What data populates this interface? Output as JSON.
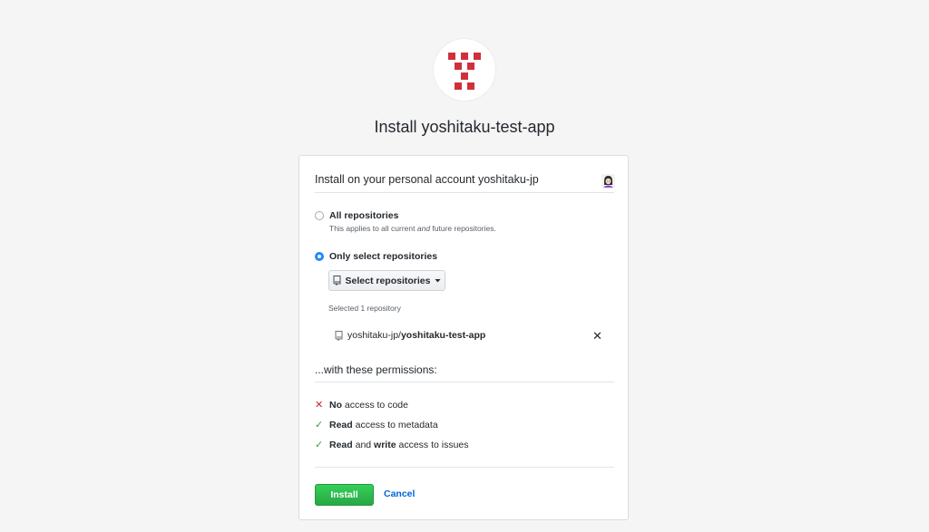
{
  "app": {
    "title": "Install yoshitaku-test-app",
    "logo_icon": "app-logo-icon",
    "logo_color": "#d0303b"
  },
  "account": {
    "label": "Install on your personal account yoshitaku-jp",
    "avatar_icon": "user-avatar-icon"
  },
  "options": {
    "all": {
      "label": "All repositories",
      "desc_prefix": "This applies to all current ",
      "desc_em": "and",
      "desc_suffix": " future repositories.",
      "selected": false
    },
    "select": {
      "label": "Only select repositories",
      "selected": true
    }
  },
  "repo_selector": {
    "button_label": "Select repositories",
    "icon": "repo-icon",
    "caret_icon": "caret-down-icon",
    "selected_count_text": "Selected 1 repository",
    "selected": [
      {
        "owner": "yoshitaku-jp/",
        "name": "yoshitaku-test-app"
      }
    ]
  },
  "permissions": {
    "heading": "...with these permissions:",
    "items": [
      {
        "status": "denied",
        "parts": [
          {
            "t": "No",
            "b": true
          },
          {
            "t": " access to code",
            "b": false
          }
        ]
      },
      {
        "status": "granted",
        "parts": [
          {
            "t": "Read",
            "b": true
          },
          {
            "t": " access to metadata",
            "b": false
          }
        ]
      },
      {
        "status": "granted",
        "parts": [
          {
            "t": "Read",
            "b": true
          },
          {
            "t": " and ",
            "b": false
          },
          {
            "t": "write",
            "b": true
          },
          {
            "t": " access to issues",
            "b": false
          }
        ]
      }
    ],
    "colors": {
      "denied": "#cb2431",
      "granted": "#28a745"
    }
  },
  "actions": {
    "install_label": "Install",
    "cancel_label": "Cancel",
    "install_color": "#2ea44f",
    "cancel_color": "#0366d6"
  }
}
